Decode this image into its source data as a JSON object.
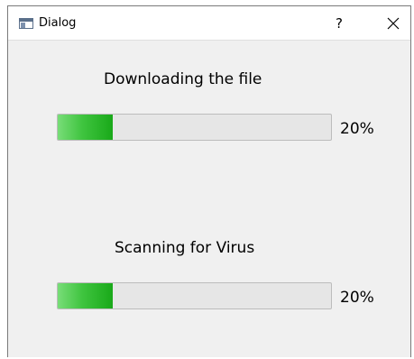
{
  "window": {
    "title": "Dialog",
    "help_label": "?",
    "app_icon": "window-icon",
    "close_icon": "close-icon"
  },
  "tasks": [
    {
      "label": "Downloading the file",
      "progress_percent": 20,
      "progress_text": "20%"
    },
    {
      "label": "Scanning for Virus",
      "progress_percent": 20,
      "progress_text": "20%"
    }
  ],
  "colors": {
    "progress_fill": "#3fc43f",
    "progress_track": "#e6e6e6"
  }
}
